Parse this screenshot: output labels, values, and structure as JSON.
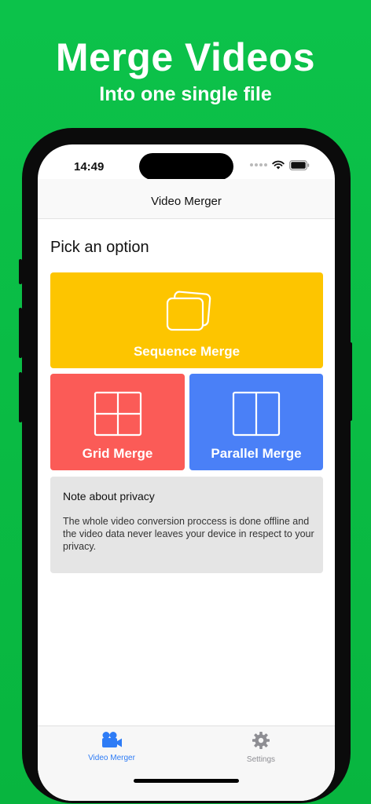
{
  "promo": {
    "title": "Merge Videos",
    "subtitle": "Into one single file"
  },
  "status_bar": {
    "time": "14:49",
    "icons": [
      "signal-dots-icon",
      "wifi-icon",
      "battery-icon"
    ]
  },
  "nav": {
    "title": "Video Merger"
  },
  "main": {
    "section_title": "Pick an option",
    "options": [
      {
        "label": "Sequence Merge",
        "icon": "stacked-frames-icon",
        "color": "#fdc500"
      },
      {
        "label": "Grid Merge",
        "icon": "grid-icon",
        "color": "#fb5b57"
      },
      {
        "label": "Parallel Merge",
        "icon": "split-columns-icon",
        "color": "#4a80f7"
      }
    ],
    "note": {
      "title": "Note about privacy",
      "body": "The whole video conversion proccess is done offline and the video data never leaves your device in respect to your privacy."
    }
  },
  "tabs": [
    {
      "label": "Video Merger",
      "icon": "video-camera-icon",
      "selected": true,
      "color": "#2e7cf6"
    },
    {
      "label": "Settings",
      "icon": "gear-icon",
      "selected": false,
      "color": "#8e8e93"
    }
  ],
  "colors": {
    "background": "#0cc24a",
    "tab_active": "#2e7cf6",
    "tab_inactive": "#8e8e93"
  }
}
